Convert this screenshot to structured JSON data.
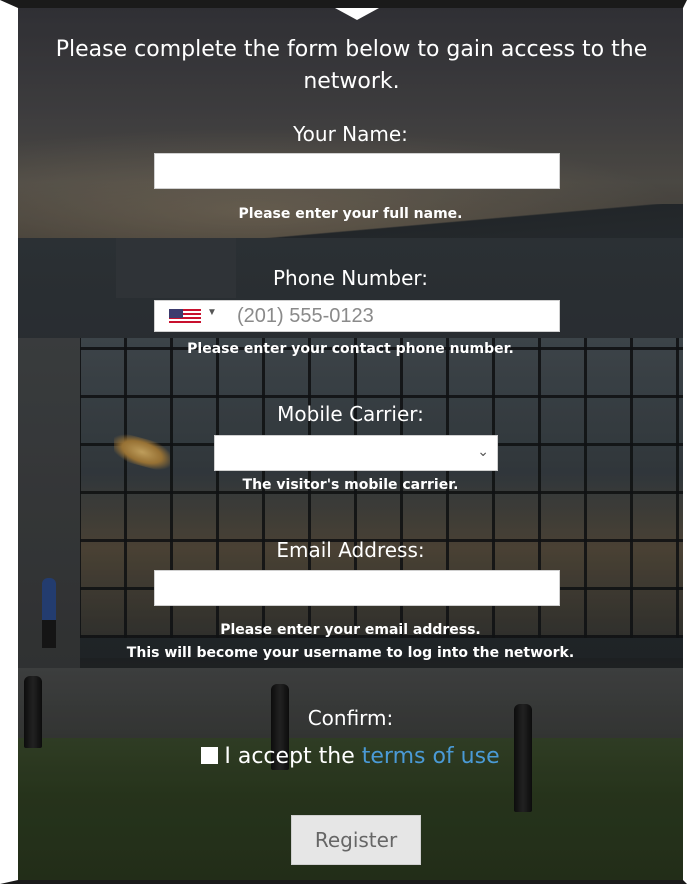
{
  "intro_text": "Please complete the form below to gain access to the network.",
  "name_field": {
    "label": "Your Name:",
    "value": "",
    "help": "Please enter your full name."
  },
  "phone_field": {
    "label": "Phone Number:",
    "country": "United States",
    "placeholder": "(201) 555-0123",
    "help": "Please enter your contact phone number."
  },
  "carrier_field": {
    "label": "Mobile Carrier:",
    "selected": "",
    "help": "The visitor's mobile carrier."
  },
  "email_field": {
    "label": "Email Address:",
    "value": "",
    "help_line1": "Please enter your email address.",
    "help_line2": "This will become your username to log into the network."
  },
  "confirm": {
    "label": "Confirm:",
    "accept_text": "I accept the",
    "terms_link": "terms of use"
  },
  "register_button": "Register",
  "colors": {
    "link": "#4a9ad6",
    "button_bg": "#e6e6e6",
    "text": "#ffffff"
  },
  "icons": {
    "flag": "us-flag-icon",
    "flag_dropdown": "caret-down-icon",
    "select_dropdown": "chevron-down-icon"
  }
}
